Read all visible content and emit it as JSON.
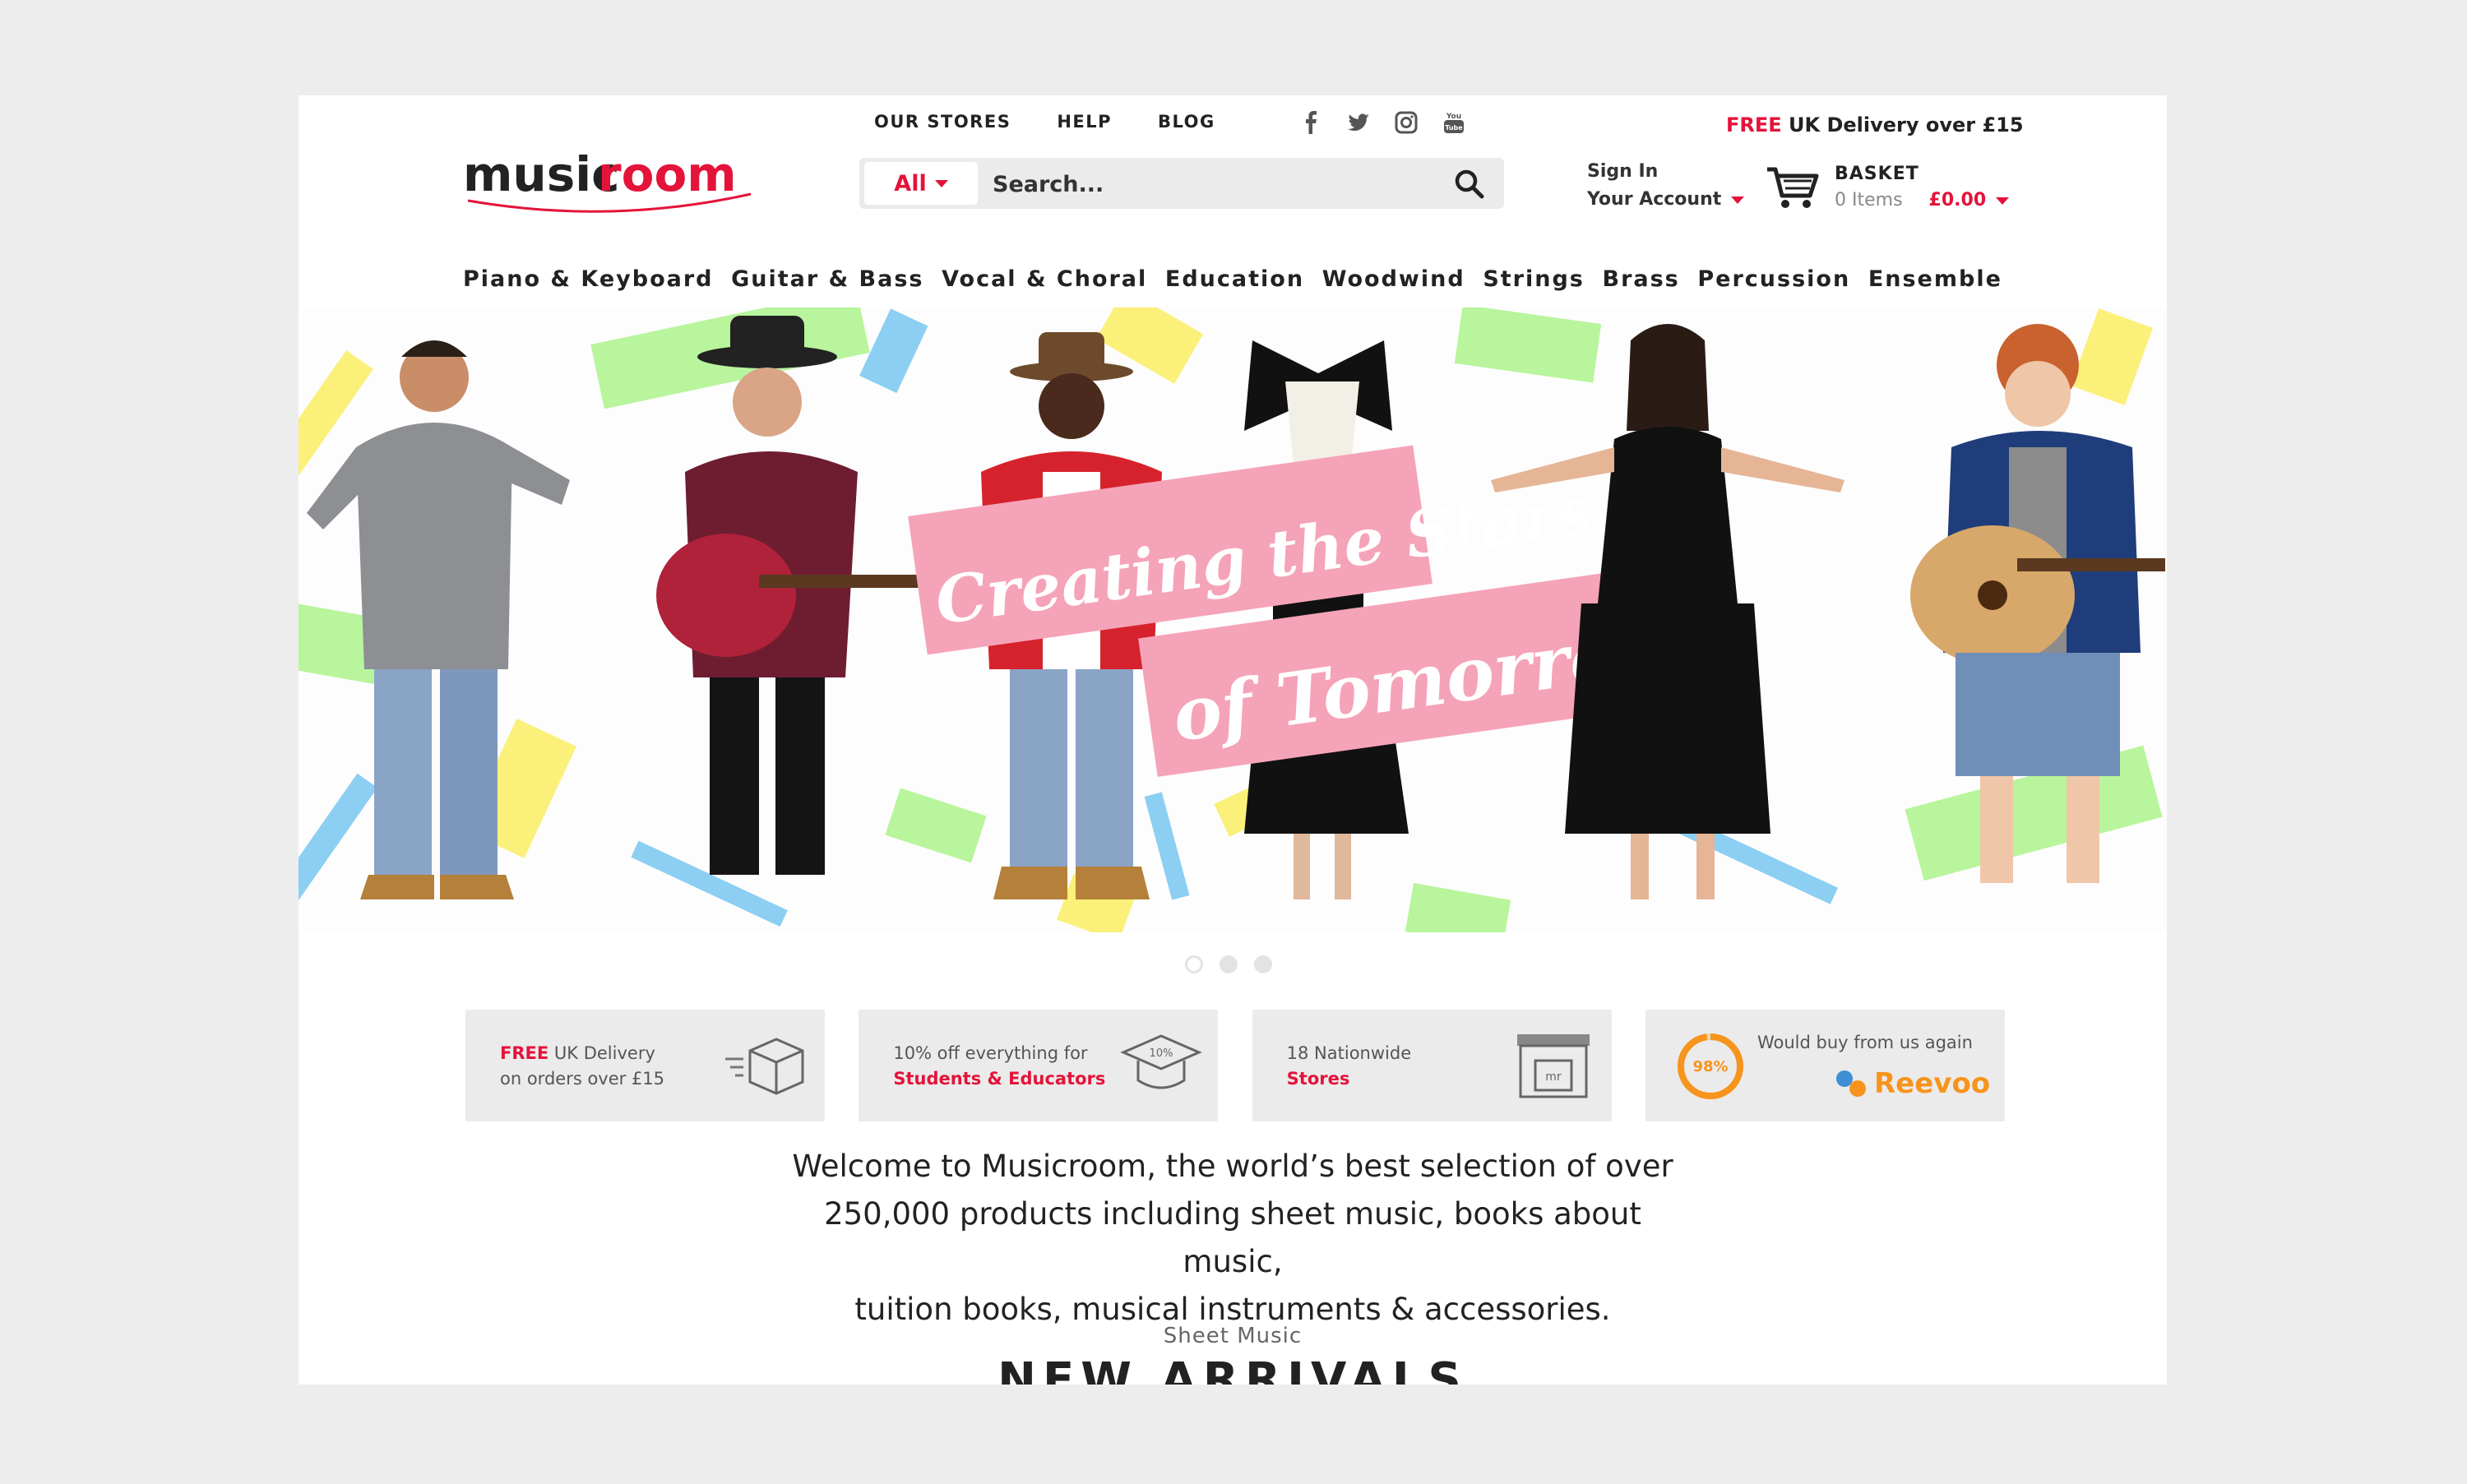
{
  "brand": {
    "logo_text_dark": "music",
    "logo_text_red": "room"
  },
  "top_nav": [
    "OUR STORES",
    "HELP",
    "BLOG"
  ],
  "social_icons": [
    "facebook-icon",
    "twitter-icon",
    "instagram-icon",
    "youtube-icon"
  ],
  "free_delivery_banner": {
    "highlight": "FREE",
    "text": " UK Delivery over £15"
  },
  "search": {
    "category": "All",
    "placeholder": "Search..."
  },
  "account": {
    "sign_in": "Sign In",
    "your_account": "Your Account"
  },
  "basket": {
    "title": "BASKET",
    "items": "0 Items",
    "price": "£0.00"
  },
  "categories": [
    "Piano & Keyboard",
    "Guitar & Bass",
    "Vocal & Choral",
    "Education",
    "Woodwind",
    "Strings",
    "Brass",
    "Percussion",
    "Ensemble"
  ],
  "hero": {
    "line1": "Creating the Stars",
    "line2": "of Tomorrow"
  },
  "carousel": {
    "slides": 3,
    "active": 1
  },
  "features": [
    {
      "red": "FREE",
      "text1": " UK Delivery",
      "text2": "on orders over £15",
      "icon": "box-icon"
    },
    {
      "text1": "10% off everything for",
      "red": "Students & Educators",
      "icon": "graduation-cap-icon",
      "badge": "10%"
    },
    {
      "text1": "18 Nationwide",
      "red": "Stores",
      "icon": "store-icon",
      "badge": "mr"
    },
    {
      "text1": "Would buy from us again",
      "logo": "Reevoo",
      "percent": "98%",
      "icon": "reevoo-icon",
      "value": 0.98
    }
  ],
  "welcome": {
    "line1": "Welcome to Musicroom, the world’s best selection of over",
    "line2": "250,000 products including sheet music, books about music,",
    "line3": "tuition books, musical instruments & accessories."
  },
  "section": {
    "label": "Sheet Music",
    "title": "NEW ARRIVALS"
  },
  "colors": {
    "accent": "#e4133a",
    "pink": "#f5a3b8",
    "green": "#b8f59c",
    "yellow": "#fbf07a",
    "blue": "#8ccff3",
    "orange": "#f7941d"
  }
}
